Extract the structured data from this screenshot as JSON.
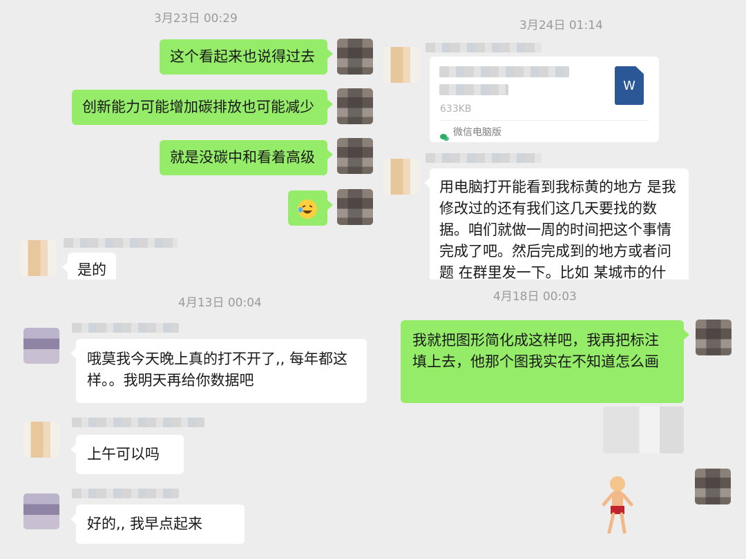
{
  "panels": {
    "top_left": {
      "timestamp": "3月23日 00:29",
      "messages": [
        {
          "text": "这个看起来也说得过去"
        },
        {
          "text": "创新能力可能增加碳排放也可能减少"
        },
        {
          "text": "就是没碳中和看着高级"
        },
        {
          "emoji": "laughing-crying-emoji"
        },
        {
          "text": "是的"
        }
      ]
    },
    "top_right": {
      "timestamp": "3月24日 01:14",
      "file_card": {
        "size": "633KB",
        "source": "微信电脑版",
        "icon_letter": "W"
      },
      "message": "用电脑打开能看到我标黄的地方 是我修改过的还有我们这几天要找的数据。咱们就做一周的时间把这个事情完成了吧。然后完成到的地方或者问题 在群里发一下。比如 某城市的什"
    },
    "bottom_left": {
      "timestamp": "4月13日 00:04",
      "messages": [
        {
          "text": "哦莫我今天晚上真的打不开了,, 每年都这样。。我明天再给你数据吧"
        },
        {
          "text": "上午可以吗"
        },
        {
          "text": "好的,, 我早点起来"
        }
      ]
    },
    "bottom_right": {
      "timestamp": "4月18日 00:03",
      "message": "我就把图形简化成这样吧，我再把标注填上去，他那个图我实在不知道怎么画"
    }
  },
  "colors": {
    "sent_bubble": "#95ec69",
    "received_bubble": "#ffffff",
    "background": "#ededed",
    "word_icon": "#2b5797"
  }
}
